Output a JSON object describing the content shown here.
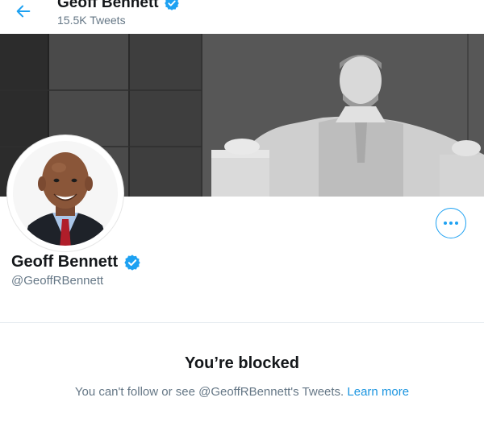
{
  "header": {
    "title": "Geoff Bennett",
    "tweet_count": "15.5K Tweets"
  },
  "profile": {
    "display_name": "Geoff Bennett",
    "handle": "@GeoffRBennett",
    "verified": true
  },
  "blocked": {
    "title": "You’re blocked",
    "message": "You can't follow or see @GeoffRBennett's Tweets.",
    "learn_more": "Learn more"
  },
  "colors": {
    "accent": "#1da1f2",
    "verified_badge": "#1da1f2",
    "secondary_text": "#657786"
  },
  "icons": {
    "back": "arrow-left-icon",
    "verified": "verified-badge-icon",
    "more": "more-horizontal-icon"
  }
}
